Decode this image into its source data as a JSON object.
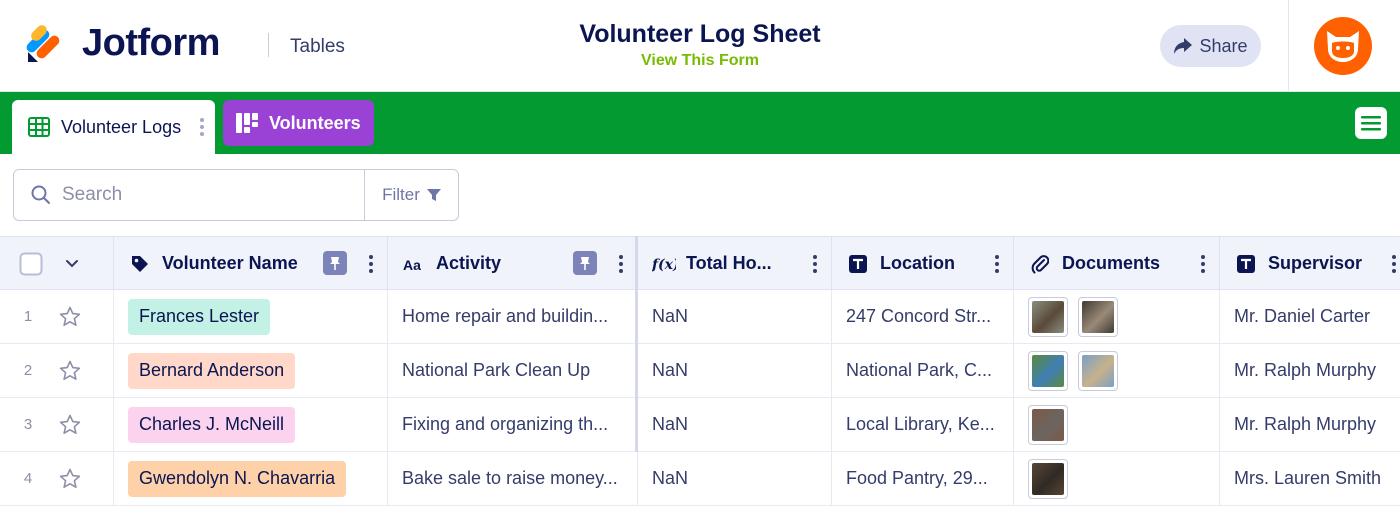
{
  "header": {
    "brand": "Jotform",
    "product": "Tables",
    "title": "Volunteer Log Sheet",
    "view_link": "View This Form",
    "share_label": "Share",
    "brand_colors": {
      "orange": "#ff6100",
      "green_bar": "#029a31",
      "purple_tab": "#9a41d6",
      "link_green": "#78bb07"
    }
  },
  "tabs": [
    {
      "label": "Volunteer Logs",
      "icon": "table-grid-icon",
      "active": true
    },
    {
      "label": "Volunteers",
      "icon": "kanban-board-icon",
      "active": false
    }
  ],
  "search": {
    "placeholder": "Search",
    "filter_label": "Filter"
  },
  "table": {
    "columns": [
      {
        "label": "Volunteer Name",
        "icon": "tag-icon",
        "pinned": true
      },
      {
        "label": "Activity",
        "icon": "text-aa-icon",
        "pinned": true
      },
      {
        "label": "Total Ho...",
        "icon": "formula-icon",
        "pinned": false
      },
      {
        "label": "Location",
        "icon": "text-t-icon",
        "pinned": false
      },
      {
        "label": "Documents",
        "icon": "paperclip-icon",
        "pinned": false
      },
      {
        "label": "Supervisor",
        "icon": "text-t-icon",
        "pinned": false
      }
    ],
    "rows": [
      {
        "num": "1",
        "name": "Frances Lester",
        "name_color": "#c4f1e6",
        "activity": "Home repair and buildin...",
        "hours": "NaN",
        "location": "247 Concord Str...",
        "documents": 2,
        "supervisor": "Mr. Daniel Carter"
      },
      {
        "num": "2",
        "name": "Bernard Anderson",
        "name_color": "#ffd8c9",
        "activity": "National Park Clean Up",
        "hours": "NaN",
        "location": "National Park, C...",
        "documents": 2,
        "supervisor": "Mr. Ralph Murphy"
      },
      {
        "num": "3",
        "name": "Charles J. McNeill",
        "name_color": "#fbd3ee",
        "activity": "Fixing and organizing th...",
        "hours": "NaN",
        "location": "Local Library, Ke...",
        "documents": 1,
        "supervisor": "Mr. Ralph Murphy"
      },
      {
        "num": "4",
        "name": "Gwendolyn N. Chavarria",
        "name_color": "#ffd1a8",
        "activity": "Bake sale to raise money...",
        "hours": "NaN",
        "location": "Food Pantry, 29...",
        "documents": 1,
        "supervisor": "Mrs. Lauren Smith"
      }
    ]
  }
}
